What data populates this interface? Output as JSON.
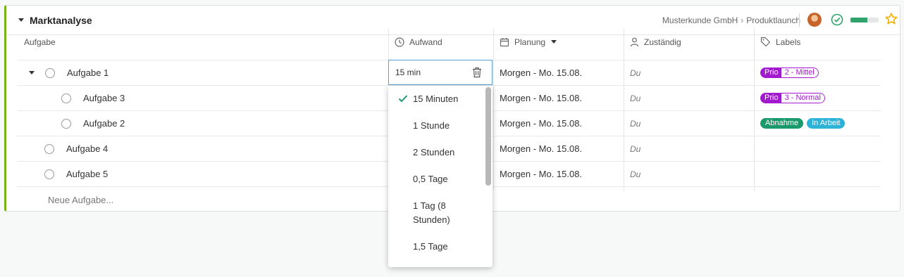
{
  "group": {
    "title": "Marktanalyse",
    "breadcrumb": [
      "Musterkunde GmbH",
      "Produktlaunch"
    ],
    "progress": 0.6,
    "colors": {
      "accent": "#7ab317",
      "progress": "#2fa36b",
      "star": "#f3b616",
      "check": "#2fa36b"
    }
  },
  "columns": {
    "task": "Aufgabe",
    "effort": "Aufwand",
    "planning": "Planung",
    "assignee": "Zuständig",
    "labels": "Labels"
  },
  "rows": [
    {
      "name": "Aufgabe 1",
      "effort": "15 min",
      "planning": "Morgen - Mo. 15.08.",
      "assignee": "Du"
    },
    {
      "name": "Aufgabe 3",
      "planning": "Morgen - Mo. 15.08.",
      "assignee": "Du"
    },
    {
      "name": "Aufgabe 2",
      "planning": "Morgen - Mo. 15.08.",
      "assignee": "Du"
    },
    {
      "name": "Aufgabe 4",
      "planning": "Morgen - Mo. 15.08.",
      "assignee": "Du"
    },
    {
      "name": "Aufgabe 5",
      "planning": "Morgen - Mo. 15.08.",
      "assignee": "Du"
    }
  ],
  "labels": {
    "row1": {
      "prefix": "Prio",
      "value": "2 - Mittel"
    },
    "row2": {
      "prefix": "Prio",
      "value": "3 - Normal"
    },
    "row3": [
      {
        "text": "Abnahme",
        "color": "#1a9a6c"
      },
      {
        "text": "In Arbeit",
        "color": "#2eb3d8"
      }
    ]
  },
  "new_task_placeholder": "Neue Aufgabe...",
  "effort_dropdown": {
    "selected": "15 Minuten",
    "options": [
      "15 Minuten",
      "1 Stunde",
      "2 Stunden",
      "0,5 Tage",
      "1 Tag (8 Stunden)",
      "1,5 Tage"
    ]
  }
}
